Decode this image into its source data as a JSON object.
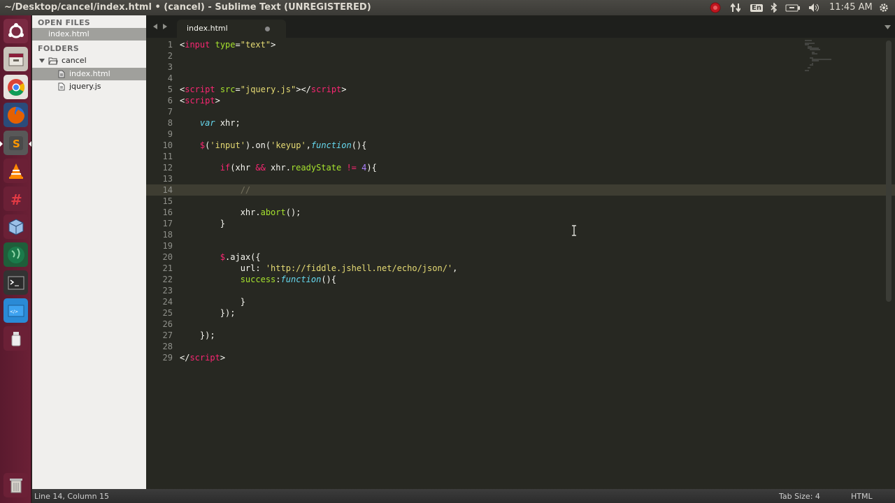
{
  "window": {
    "title": "~/Desktop/cancel/index.html • (cancel) - Sublime Text (UNREGISTERED)"
  },
  "tray": {
    "keyboard_layout": "En",
    "clock": "11:45 AM"
  },
  "launcher": {
    "items": [
      "ubuntu-dash",
      "file-manager",
      "chrome",
      "firefox",
      "sublime-text",
      "vlc",
      "hexchat",
      "virtualbox",
      "globe",
      "terminal",
      "code-app",
      "usb-drive",
      "trash"
    ]
  },
  "sidebar": {
    "open_files_heading": "OPEN FILES",
    "open_files": [
      {
        "label": "index.html",
        "selected": true
      }
    ],
    "folders_heading": "FOLDERS",
    "folder": {
      "label": "cancel",
      "expanded": true
    },
    "files": [
      {
        "label": "index.html",
        "selected": true
      },
      {
        "label": "jquery.js",
        "selected": false
      }
    ]
  },
  "tabs": [
    {
      "label": "index.html",
      "modified": true
    }
  ],
  "editor": {
    "current_line": 14,
    "line_numbers": [
      "1",
      "2",
      "3",
      "4",
      "5",
      "6",
      "7",
      "8",
      "9",
      "10",
      "11",
      "12",
      "13",
      "14",
      "15",
      "16",
      "17",
      "18",
      "19",
      "20",
      "21",
      "22",
      "23",
      "24",
      "25",
      "26",
      "27",
      "28",
      "29"
    ],
    "lines": [
      [
        [
          "t-pun",
          "<"
        ],
        [
          "t-tag",
          "input"
        ],
        [
          "t-pun",
          " "
        ],
        [
          "t-attr",
          "type"
        ],
        [
          "t-pun",
          "="
        ],
        [
          "t-str",
          "\"text\""
        ],
        [
          "t-pun",
          ">"
        ]
      ],
      [],
      [],
      [],
      [
        [
          "t-pun",
          "<"
        ],
        [
          "t-tag",
          "script"
        ],
        [
          "t-pun",
          " "
        ],
        [
          "t-attr",
          "src"
        ],
        [
          "t-pun",
          "="
        ],
        [
          "t-str",
          "\"jquery.js\""
        ],
        [
          "t-pun",
          "></"
        ],
        [
          "t-tag",
          "script"
        ],
        [
          "t-pun",
          ">"
        ]
      ],
      [
        [
          "t-pun",
          "<"
        ],
        [
          "t-tag",
          "script"
        ],
        [
          "t-pun",
          ">"
        ]
      ],
      [],
      [
        [
          "t-pun",
          "    "
        ],
        [
          "t-kw",
          "var"
        ],
        [
          "t-pun",
          " xhr;"
        ]
      ],
      [],
      [
        [
          "t-pun",
          "    "
        ],
        [
          "t-op",
          "$"
        ],
        [
          "t-pun",
          "("
        ],
        [
          "t-str",
          "'input'"
        ],
        [
          "t-pun",
          ")."
        ],
        [
          "t-pun",
          "on("
        ],
        [
          "t-str",
          "'keyup'"
        ],
        [
          "t-pun",
          ","
        ],
        [
          "t-kw",
          "function"
        ],
        [
          "t-pun",
          "(){"
        ]
      ],
      [],
      [
        [
          "t-pun",
          "        "
        ],
        [
          "t-op",
          "if"
        ],
        [
          "t-pun",
          "(xhr "
        ],
        [
          "t-op",
          "&&"
        ],
        [
          "t-pun",
          " xhr."
        ],
        [
          "t-fn",
          "readyState"
        ],
        [
          "t-pun",
          " "
        ],
        [
          "t-op",
          "!="
        ],
        [
          "t-pun",
          " "
        ],
        [
          "t-num",
          "4"
        ],
        [
          "t-pun",
          "){"
        ]
      ],
      [],
      [
        [
          "t-pun",
          "            "
        ],
        [
          "t-cmt",
          "//"
        ]
      ],
      [],
      [
        [
          "t-pun",
          "            xhr."
        ],
        [
          "t-fn",
          "abort"
        ],
        [
          "t-pun",
          "();"
        ]
      ],
      [
        [
          "t-pun",
          "        }"
        ]
      ],
      [],
      [],
      [
        [
          "t-pun",
          "        "
        ],
        [
          "t-op",
          "$"
        ],
        [
          "t-pun",
          "."
        ],
        [
          "t-pun",
          "ajax({"
        ]
      ],
      [
        [
          "t-pun",
          "            url: "
        ],
        [
          "t-str",
          "'http://fiddle.jshell.net/echo/json/'"
        ],
        [
          "t-pun",
          ","
        ]
      ],
      [
        [
          "t-pun",
          "            "
        ],
        [
          "t-fn",
          "success"
        ],
        [
          "t-pun",
          ":"
        ],
        [
          "t-kw",
          "function"
        ],
        [
          "t-pun",
          "(){"
        ]
      ],
      [],
      [
        [
          "t-pun",
          "            }"
        ]
      ],
      [
        [
          "t-pun",
          "        });"
        ]
      ],
      [],
      [
        [
          "t-pun",
          "    });"
        ]
      ],
      [],
      [
        [
          "t-pun",
          "</"
        ],
        [
          "t-tag",
          "script"
        ],
        [
          "t-pun",
          ">"
        ]
      ]
    ]
  },
  "statusbar": {
    "position": "Line 14, Column 15",
    "tab_size": "Tab Size: 4",
    "syntax": "HTML"
  }
}
